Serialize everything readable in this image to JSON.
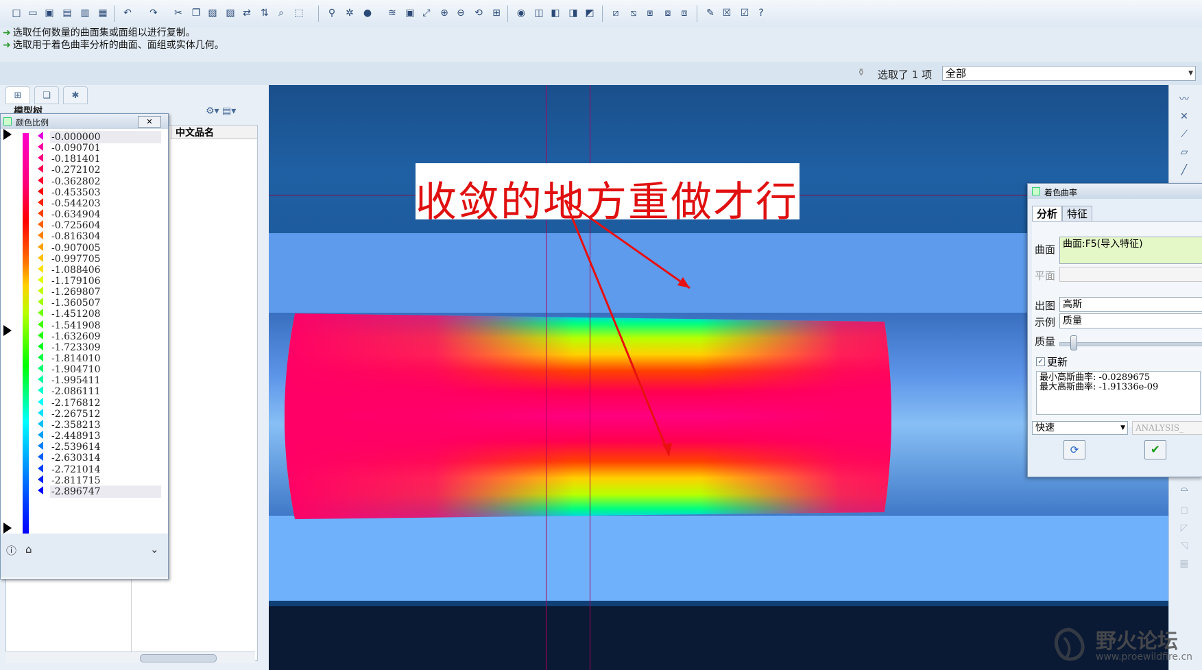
{
  "messages": [
    "选取任何数量的曲面集或面组以进行复制。",
    "选取用于着色曲率分析的曲面、面组或实体几何。"
  ],
  "selection": {
    "label": "选取了 1 项",
    "filter_value": "全部"
  },
  "model_tree": {
    "header": "模型树",
    "column_header": "中文品名"
  },
  "color_scale": {
    "title": "颜色比例",
    "close_label": "✕",
    "values": [
      "-0.000000",
      "-0.090701",
      "-0.181401",
      "-0.272102",
      "-0.362802",
      "-0.453503",
      "-0.544203",
      "-0.634904",
      "-0.725604",
      "-0.816304",
      "-0.907005",
      "-0.997705",
      "-1.088406",
      "-1.179106",
      "-1.269807",
      "-1.360507",
      "-1.451208",
      "-1.541908",
      "-1.632609",
      "-1.723309",
      "-1.814010",
      "-1.904710",
      "-1.995411",
      "-2.086111",
      "-2.176812",
      "-2.267512",
      "-2.358213",
      "-2.448913",
      "-2.539614",
      "-2.630314",
      "-2.721014",
      "-2.811715",
      "-2.896747"
    ]
  },
  "annotation": {
    "text": "收敛的地方重做才行"
  },
  "dialog": {
    "title": "着色曲率",
    "tabs": [
      "分析",
      "特征"
    ],
    "surface_label": "曲面",
    "surface_value": "曲面:F5(导入特征)",
    "plane_label": "平面",
    "plot_label": "出图",
    "plot_value": "高斯",
    "display_label": "示例",
    "display_value": "质量",
    "quality_label": "质量",
    "update_label": "更新",
    "result_line1": "最小高斯曲率: -0.0289675",
    "result_line2": "最大高斯曲率: -1.91336e-09",
    "speed_value": "快速",
    "analysis_name": "ANALYSIS_"
  },
  "watermark": {
    "title": "野火论坛",
    "url": "www.proewildfire.cn"
  },
  "colors": {
    "annotation_red": "#e01010",
    "viewport_blue": "#1f60a4",
    "surface_magenta": "#ff0066"
  }
}
